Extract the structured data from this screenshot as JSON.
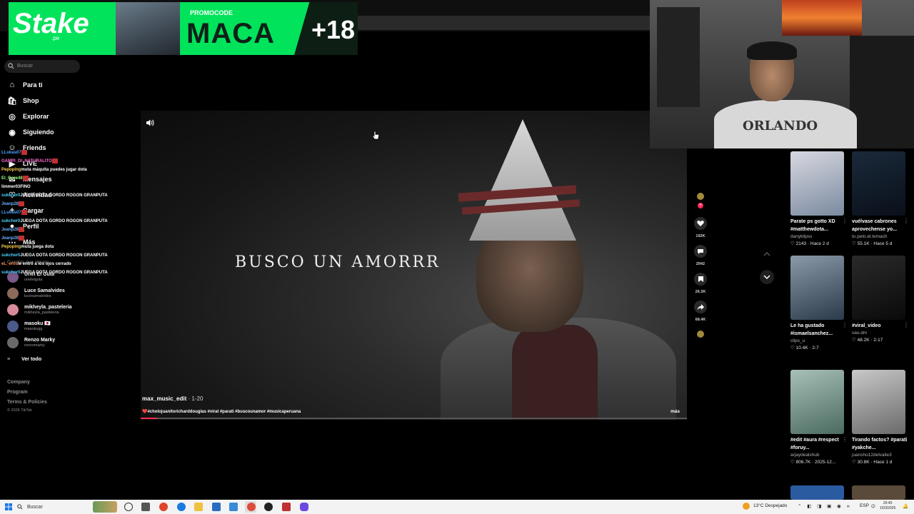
{
  "ad": {
    "brand": "Stake",
    "brand_sub": ".pe",
    "promo_label": "PROMOCODE",
    "promo_code": "MACA",
    "age": "+18"
  },
  "sidebar": {
    "search_placeholder": "Buscar",
    "nav": [
      {
        "label": "Para ti",
        "icon": "home-icon"
      },
      {
        "label": "Shop",
        "icon": "shop-icon"
      },
      {
        "label": "Explorar",
        "icon": "compass-icon"
      },
      {
        "label": "Siguiendo",
        "icon": "following-icon"
      },
      {
        "label": "Friends",
        "icon": "friends-icon"
      },
      {
        "label": "LIVE",
        "icon": "live-icon"
      },
      {
        "label": "Mensajes",
        "icon": "messages-icon"
      },
      {
        "label": "Actividad",
        "icon": "activity-icon"
      },
      {
        "label": "Cargar",
        "icon": "upload-icon"
      },
      {
        "label": "Perfil",
        "icon": "profile-icon"
      },
      {
        "label": "Más",
        "icon": "more-icon"
      }
    ],
    "following_title": "Cuentas que sigues",
    "following": [
      {
        "name": "Uriel El Gutá",
        "handle": "urielelguta",
        "color": "#7a5a8a"
      },
      {
        "name": "Luce Samalvides",
        "handle": "lucesamalvides",
        "color": "#8a6a5a"
      },
      {
        "name": "mikheyla_pasteleria",
        "handle": "mikheyla_pasteleria",
        "color": "#d98a9a"
      },
      {
        "name": "masoku 🇯🇵",
        "handle": "masokugg",
        "color": "#4a5a8a"
      },
      {
        "name": "Renzo Marky",
        "handle": "renzomarky",
        "color": "#6a6a6a"
      }
    ],
    "see_all": "Ver todo",
    "footer": [
      "Company",
      "Program",
      "Terms & Policies",
      "© 2026 TikTok"
    ]
  },
  "chat": [
    {
      "user": "LLukas07",
      "color": "#4da3ff",
      "text": ""
    },
    {
      "user": "GAMPI_DI_NATURALITO",
      "color": "#ff6ad5",
      "text": ""
    },
    {
      "user": "Pepoping",
      "color": "#ffd24d",
      "text": "muta máquita puedes jugar dota"
    },
    {
      "user": "El_Gore48",
      "color": "#9dff7a",
      "text": ""
    },
    {
      "user": "limmer03",
      "color": "#ffffff",
      "text": "FINO"
    },
    {
      "user": "sukcher0",
      "color": "#4dd2ff",
      "text": "JUEGA DOTA GORDO ROGON GRANPUTA"
    },
    {
      "user": "Jeanp28",
      "color": "#6ab0ff",
      "text": ""
    },
    {
      "user": "LLukas07",
      "color": "#4da3ff",
      "text": ""
    },
    {
      "user": "sukcher0",
      "color": "#4dd2ff",
      "text": "JUEGA DOTA GORDO ROGON GRANPUTA"
    },
    {
      "user": "Jeanp28",
      "color": "#6ab0ff",
      "text": ""
    },
    {
      "user": "Jeanp28",
      "color": "#6ab0ff",
      "text": ""
    },
    {
      "user": "Pepoping",
      "color": "#ffd24d",
      "text": "muta juega dota"
    },
    {
      "user": "sukcher0",
      "color": "#4dd2ff",
      "text": "JUEGA DOTA GORDO ROGON GRANPUTA"
    },
    {
      "user": "eL_eros",
      "color": "#ff8a4d",
      "text": "le entró a los ojos cerrado"
    },
    {
      "user": "sukcher0",
      "color": "#4dd2ff",
      "text": "JUEGA DOTA GORDO ROGON GRANPUTA"
    }
  ],
  "video": {
    "lyric": "BUSCO UN AMORRR",
    "author": "max_music_edit",
    "date": "· 1-20",
    "caption": "❤️#cholojuanitoricharddouglas #viral #parati #buscounamor #musicaperuana",
    "more": "más",
    "progress": 0.03,
    "counts": {
      "likes": "192K",
      "comments": "2942",
      "saves": "26.3K",
      "shares": "68.4K"
    }
  },
  "webcam": {
    "shirt_text": "ORLANDO"
  },
  "grid": [
    {
      "title": "Parate ps gotto XD #matthewdota...",
      "user": "danyklipss",
      "meta": "♡ 2143 · Hace 2 d",
      "bg": "linear-gradient(160deg,#d8d8e0,#7a8aa0)"
    },
    {
      "title": "vuélvase cabrones aprovechense yo...",
      "user": "tu.pelo.el.temach",
      "meta": "♡ 55.1K · Hace 5 d",
      "bg": "linear-gradient(160deg,#1a2a3a,#0a0f1a)"
    },
    {
      "title": "Le ha gustado #ismaelsanchez...",
      "user": "clips_u",
      "meta": "♡ 10.4K · 2-7",
      "bg": "linear-gradient(160deg,#8a9aa8,#2a3a4a)"
    },
    {
      "title": "#viral_video",
      "user": "vao.dm",
      "meta": "♡ 48.2K · 2-17",
      "bg": "linear-gradient(160deg,#2a2a2a,#0a0a0a)"
    },
    {
      "title": "#edit #aura #respect #foruy...",
      "user": "arjaydealshub",
      "meta": "♡ 806.7K · 2025-12...",
      "bg": "linear-gradient(160deg,#a8c0b8,#4a6a60)"
    },
    {
      "title": "Tirando factos? #parati #yakche...",
      "user": "juansho12delvalle3",
      "meta": "♡ 30.8K · Hace 1 d",
      "bg": "linear-gradient(160deg,#c8c8c8,#6a6a6a)"
    }
  ],
  "taskbar": {
    "search": "Buscar",
    "weather": "13°C  Despejado",
    "lang": "ESP",
    "time": "20:45",
    "date": "1/03/2026"
  }
}
